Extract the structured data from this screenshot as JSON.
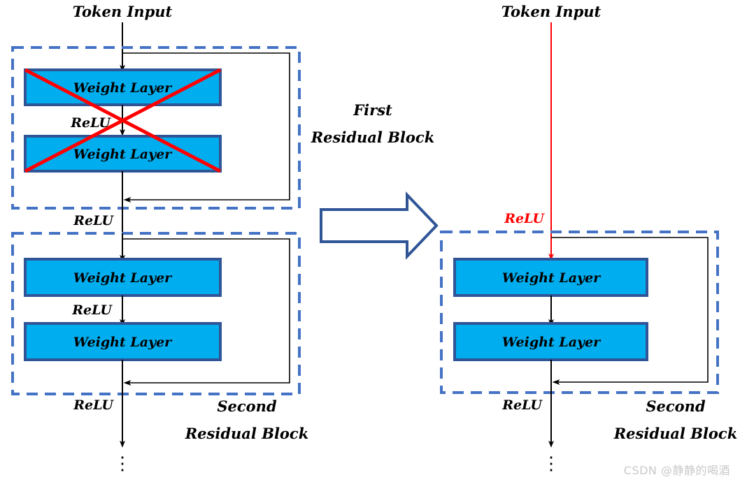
{
  "figure": {
    "title": "Residual block modification diagram",
    "watermark": "CSDN @静静的喝酒",
    "colors": {
      "weight_box_fill": "#00AEEF",
      "weight_box_stroke": "#2F5597",
      "dashed_block_stroke": "#4472C4",
      "cross_mark": "#FF0000",
      "relu_highlight": "#FF0000",
      "flow_line": "#000000",
      "watermark_text": "#C9C9C9"
    }
  },
  "left_panel": {
    "token_input_label": "Token Input",
    "first_block": {
      "weight_layer_1": "Weight Layer",
      "relu_inner": "ReLU",
      "weight_layer_2": "Weight Layer",
      "relu_output": "ReLU",
      "crossed_out": true
    },
    "second_block": {
      "weight_layer_1": "Weight Layer",
      "relu_inner": "ReLU",
      "weight_layer_2": "Weight Layer",
      "relu_output": "ReLU",
      "title_line_1": "Second",
      "title_line_2": "Residual Block"
    },
    "continuation_dots": "⋮"
  },
  "center": {
    "first_block_title_line_1": "First",
    "first_block_title_line_2": "Residual Block",
    "transform_arrow": "right-arrow"
  },
  "right_panel": {
    "token_input_label": "Token Input",
    "relu_highlight_label": "ReLU",
    "second_block": {
      "weight_layer_1": "Weight Layer",
      "weight_layer_2": "Weight Layer",
      "relu_output": "ReLU",
      "title_line_1": "Second",
      "title_line_2": "Residual Block"
    },
    "continuation_dots": "⋮"
  }
}
